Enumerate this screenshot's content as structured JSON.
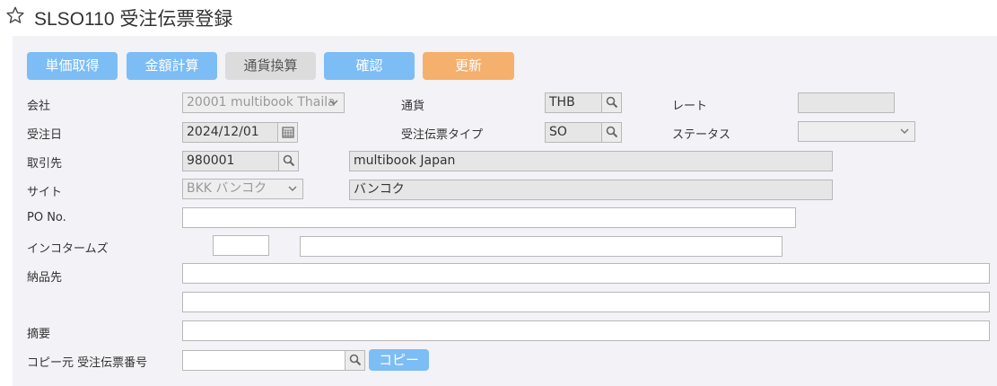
{
  "header": {
    "title": "SLSO110 受注伝票登録",
    "star_icon": "star-outline-icon"
  },
  "toolbar": {
    "unit_price": "単価取得",
    "amount_calc": "金額計算",
    "currency_conv": "通貨換算",
    "confirm": "確認",
    "update": "更新"
  },
  "form": {
    "company_label": "会社",
    "company_value": "20001 multibook Thaila",
    "currency_label": "通貨",
    "currency_value": "THB",
    "rate_label": "レート",
    "rate_value": "",
    "order_date_label": "受注日",
    "order_date_value": "2024/12/01",
    "slip_type_label": "受注伝票タイプ",
    "slip_type_value": "SO",
    "status_label": "ステータス",
    "status_value": "",
    "customer_label": "取引先",
    "customer_code": "980001",
    "customer_name": "multibook Japan",
    "site_label": "サイト",
    "site_value": "BKK バンコク",
    "site_name": "バンコク",
    "po_label": "PO No.",
    "po_value": "",
    "incoterms_label": "インコタームズ",
    "incoterms_code": "",
    "incoterms_desc": "",
    "delivery_label": "納品先",
    "delivery_line1": "",
    "delivery_line2": "",
    "summary_label": "摘要",
    "summary_value": "",
    "copy_source_label": "コピー元 受注伝票番号",
    "copy_source_value": "",
    "copy_button": "コピー"
  }
}
